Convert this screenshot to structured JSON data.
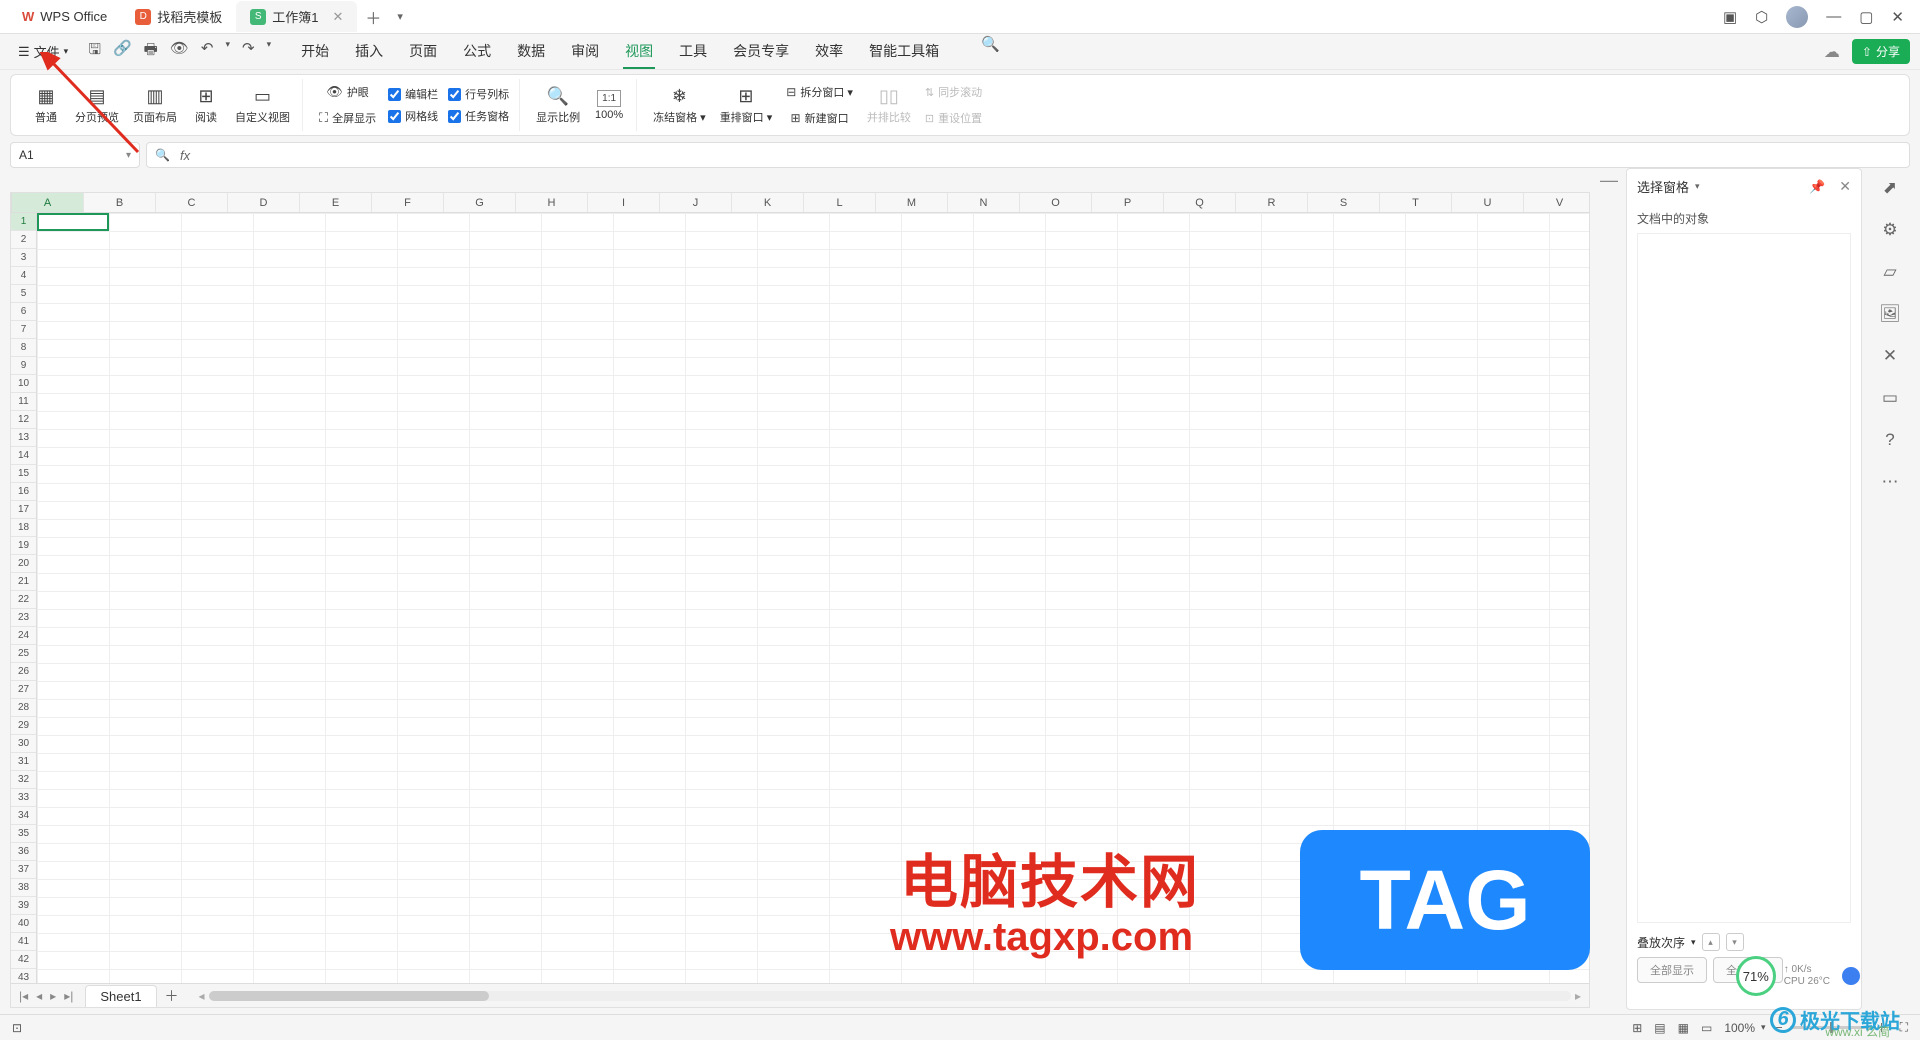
{
  "titlebar": {
    "tabs": [
      {
        "icon": "wps",
        "label": "WPS Office"
      },
      {
        "icon": "dao",
        "label": "找稻壳模板"
      },
      {
        "icon": "sheet",
        "label": "工作簿1",
        "active": true
      }
    ],
    "window_btns": {
      "min": "—",
      "max": "▢",
      "close": "✕"
    }
  },
  "menubar": {
    "file": "文件",
    "tabs": [
      "开始",
      "插入",
      "页面",
      "公式",
      "数据",
      "审阅",
      "视图",
      "工具",
      "会员专享",
      "效率",
      "智能工具箱"
    ],
    "active_tab": "视图",
    "share": "分享"
  },
  "ribbon": {
    "views": {
      "normal": "普通",
      "page_preview": "分页预览",
      "page_layout": "页面布局",
      "read": "阅读",
      "custom": "自定义视图"
    },
    "eye_protect": "护眼",
    "fullscreen": "全屏显示",
    "checks": {
      "editbar": "编辑栏",
      "rowcol": "行号列标",
      "gridlines": "网格线",
      "taskpane": "任务窗格"
    },
    "zoom": {
      "label": "显示比例",
      "percent": "100%"
    },
    "freeze": "冻结窗格",
    "arrange": "重排窗口",
    "split": "拆分窗口",
    "newwin": "新建窗口",
    "sidebyside": "并排比较",
    "syncscroll": "同步滚动",
    "resetpos": "重设位置"
  },
  "formula": {
    "cell_ref": "A1",
    "fx": "fx"
  },
  "grid": {
    "cols": [
      "A",
      "B",
      "C",
      "D",
      "E",
      "F",
      "G",
      "H",
      "I",
      "J",
      "K",
      "L",
      "M",
      "N",
      "O",
      "P",
      "Q",
      "R",
      "S",
      "T",
      "U",
      "V"
    ],
    "row_count": 43,
    "sel_col": 0,
    "sel_row": 1
  },
  "sheet": {
    "name": "Sheet1"
  },
  "right_panel": {
    "title": "选择窗格",
    "subtitle": "文档中的对象",
    "order_label": "叠放次序",
    "show_all": "全部显示",
    "hide_all": "全部隐藏"
  },
  "statusbar": {
    "zoom": "100%"
  },
  "watermark": {
    "red_text": "电脑技术网",
    "red_url": "www.tagxp.com",
    "tag": "TAG",
    "jiguang": "极光下载站",
    "url2": "www.xi  么简"
  },
  "cpu": {
    "pct": "71%",
    "speed": "0K/s",
    "temp": "CPU 26°C"
  }
}
